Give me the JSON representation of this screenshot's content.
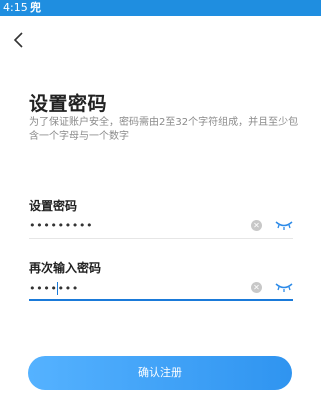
{
  "status_bar": {
    "time": "4:15",
    "carrier_glyph": "兜"
  },
  "header": {
    "title": "设置密码",
    "subtitle": "为了保证账户安全，密码需由2至32个字符组成，并且至少包含一个字母与一个数字"
  },
  "password": {
    "label": "设置密码",
    "value": "•••••••••"
  },
  "confirm_password": {
    "label": "再次输入密码",
    "value": "•••••••"
  },
  "register_button": {
    "label": "确认注册"
  },
  "colors": {
    "accent": "#1a7ad9",
    "button_start": "#55b2ff",
    "button_end": "#2f94f0",
    "status_bar": "#1f8ee0"
  }
}
